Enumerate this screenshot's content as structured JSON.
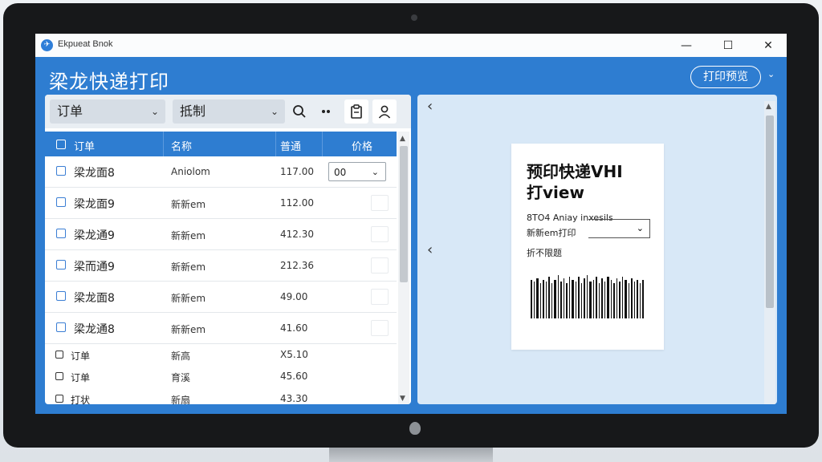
{
  "window": {
    "title": "Ekpueat Bnok",
    "controls": {
      "minimize": "—",
      "maximize": "☐",
      "close": "✕"
    }
  },
  "app": {
    "heading": "梁龙快递打印",
    "preview_button": "打印预览",
    "preview_caret": "⌄"
  },
  "toolbar": {
    "select_order": "订单",
    "select_filter": "抵制",
    "icons": [
      "search-icon",
      "more-icon",
      "clipboard-icon",
      "user-icon"
    ]
  },
  "table": {
    "headers": [
      "订单",
      "名称",
      "普通",
      "价格"
    ],
    "rows": [
      {
        "name": "梁龙面8",
        "item": "Aniolom",
        "price": "117.00",
        "qty": "00"
      },
      {
        "name": "梁龙面9",
        "item": "新新em",
        "price": "112.00"
      },
      {
        "name": "梁龙通9",
        "item": "新新em",
        "price": "412.30"
      },
      {
        "name": "梁而通9",
        "item": "新新em",
        "price": "212.36"
      },
      {
        "name": "梁龙面8",
        "item": "新新em",
        "price": "49.00"
      },
      {
        "name": "梁龙通8",
        "item": "新新em",
        "price": "41.60"
      }
    ],
    "small_rows": [
      {
        "name": "订单",
        "item": "新高",
        "price": "X5.10"
      },
      {
        "name": "订单",
        "item": "育溪",
        "price": "45.60"
      },
      {
        "name": "打状",
        "item": "新扇",
        "price": "43.30"
      }
    ]
  },
  "preview": {
    "label_title_line1": "预印快递VHI",
    "label_title_line2": "打view",
    "info_line": "8TO4 Aniay inxesils",
    "print_line": "新新em打印",
    "note_line": "折不限题",
    "prev_arrow_top": "‹",
    "prev_arrow_mid": "‹"
  }
}
